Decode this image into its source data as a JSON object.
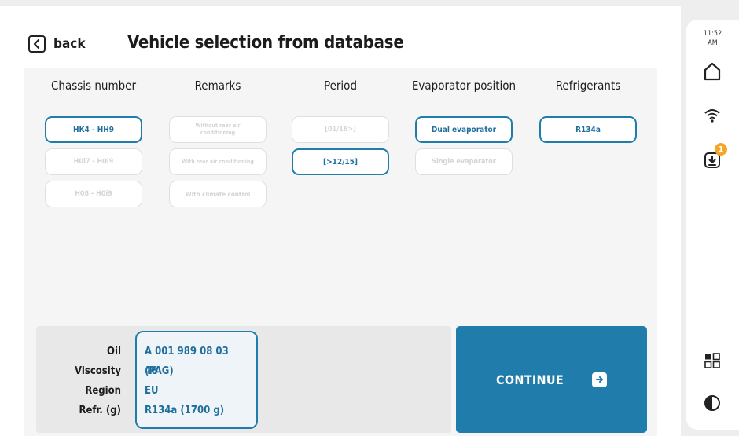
{
  "header": {
    "back_label": "back",
    "title": "Vehicle selection from database"
  },
  "columns": [
    {
      "title": "Chassis number",
      "options": [
        {
          "label": "HK4 - HH9",
          "state": "selected"
        },
        {
          "label": "H0i7 - H0i9",
          "state": "disabled"
        },
        {
          "label": "H08 - H0i9",
          "state": "disabled"
        }
      ]
    },
    {
      "title": "Remarks",
      "options": [
        {
          "label": "Without rear air conditioning",
          "state": "disabled"
        },
        {
          "label": "With rear air conditioning",
          "state": "disabled"
        },
        {
          "label": "With climate control",
          "state": "disabled"
        }
      ]
    },
    {
      "title": "Period",
      "options": [
        {
          "label": "[01/16>]",
          "state": "disabled"
        },
        {
          "label": "[>12/15]",
          "state": "selected"
        }
      ]
    },
    {
      "title": "Evaporator position",
      "options": [
        {
          "label": "Dual evaporator",
          "state": "selected"
        },
        {
          "label": "Single evaporator",
          "state": "disabled"
        }
      ]
    },
    {
      "title": "Refrigerants",
      "options": [
        {
          "label": "R134a",
          "state": "selected"
        }
      ]
    }
  ],
  "summary": {
    "labels": {
      "oil": "Oil",
      "viscosity": "Viscosity",
      "region": "Region",
      "refrigerant": "Refr. (g)"
    },
    "values": {
      "oil": "A 001 989 08 03 (PAG)",
      "viscosity": "46",
      "region": "EU",
      "refrigerant": "R134a (1700 g)"
    }
  },
  "continue_label": "CONTINUE",
  "sidebar": {
    "time": "11:52",
    "ampm": "AM",
    "download_badge": "1",
    "icons": [
      "home-icon",
      "wifi-icon",
      "download-icon",
      "apps-icon",
      "contrast-icon"
    ]
  },
  "colors": {
    "accent": "#1f7cab",
    "badge": "#f5a623"
  }
}
